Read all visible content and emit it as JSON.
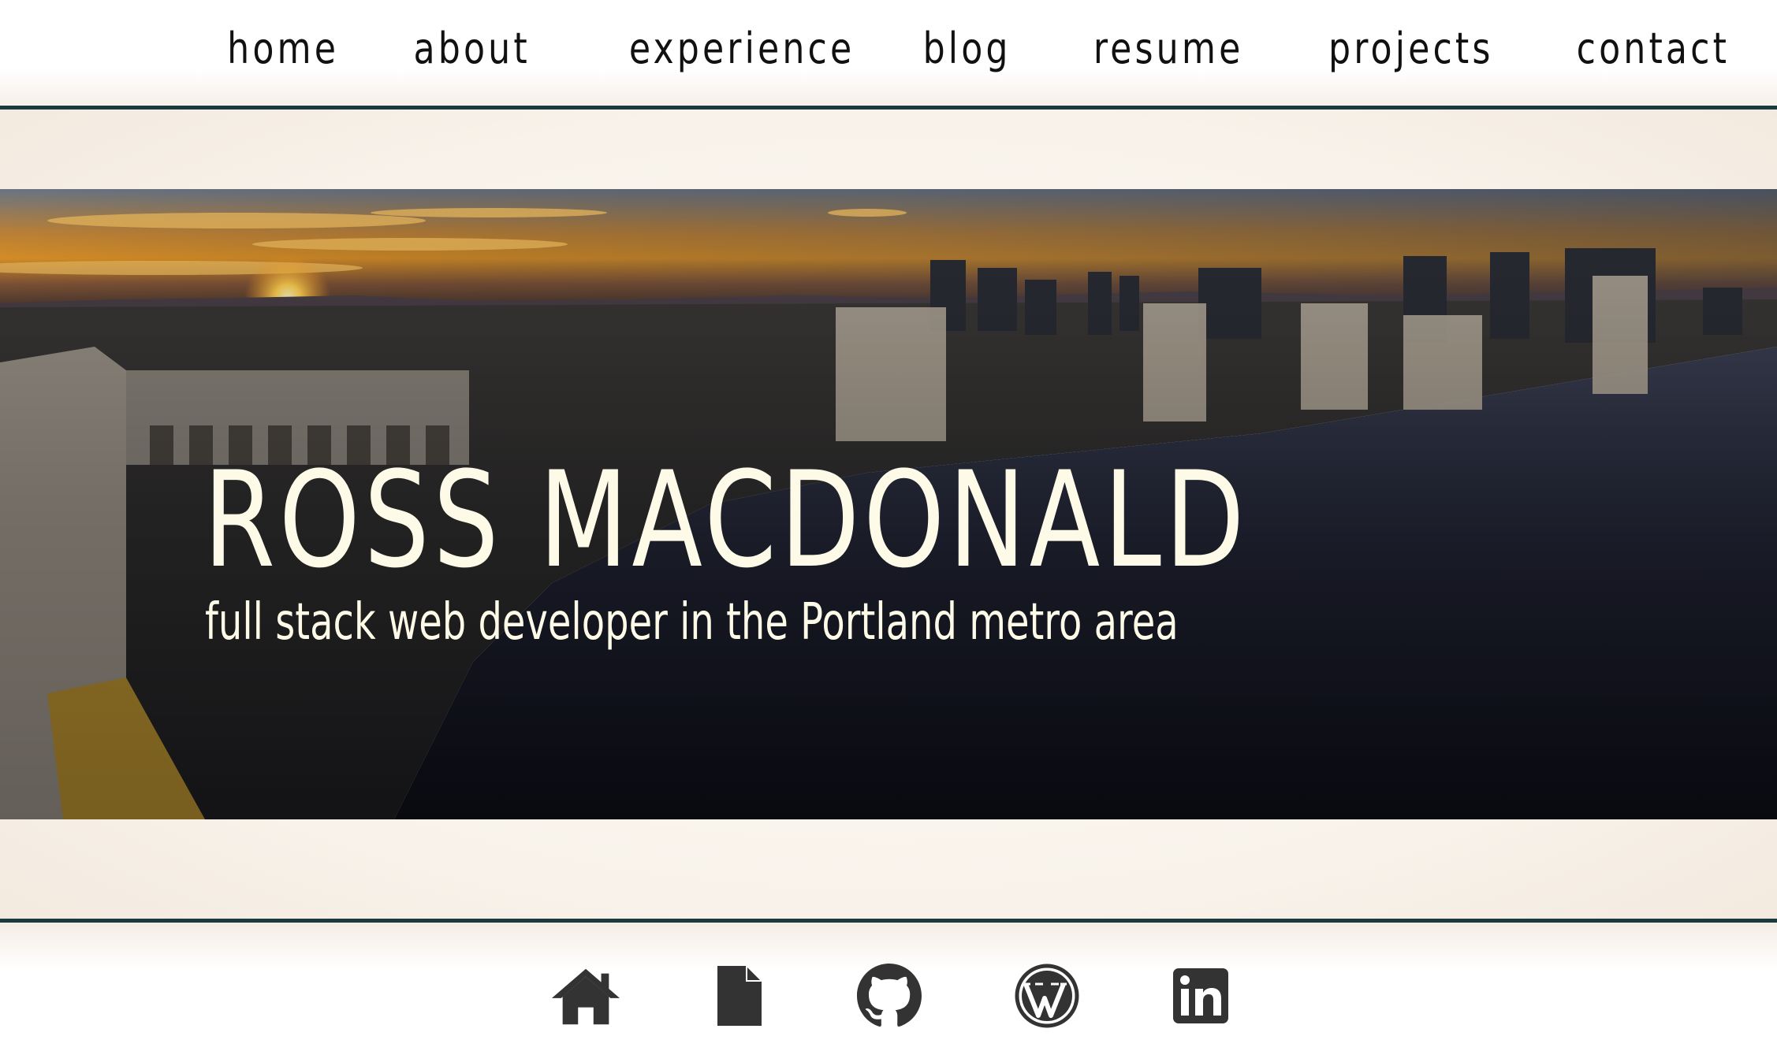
{
  "nav": {
    "links": [
      "home",
      "about",
      "experience",
      "blog",
      "resume",
      "projects",
      "contact"
    ]
  },
  "hero": {
    "title": "ROSS MACDONALD",
    "subtitle": "full stack web developer in the Portland metro area"
  },
  "footer": {
    "icons": [
      "home-icon",
      "document-icon",
      "github-icon",
      "wordpress-icon",
      "linkedin-icon"
    ]
  },
  "colors": {
    "accent_rule": "#1b3a3d",
    "hero_text": "#fdfbe8",
    "icon": "#333333"
  }
}
